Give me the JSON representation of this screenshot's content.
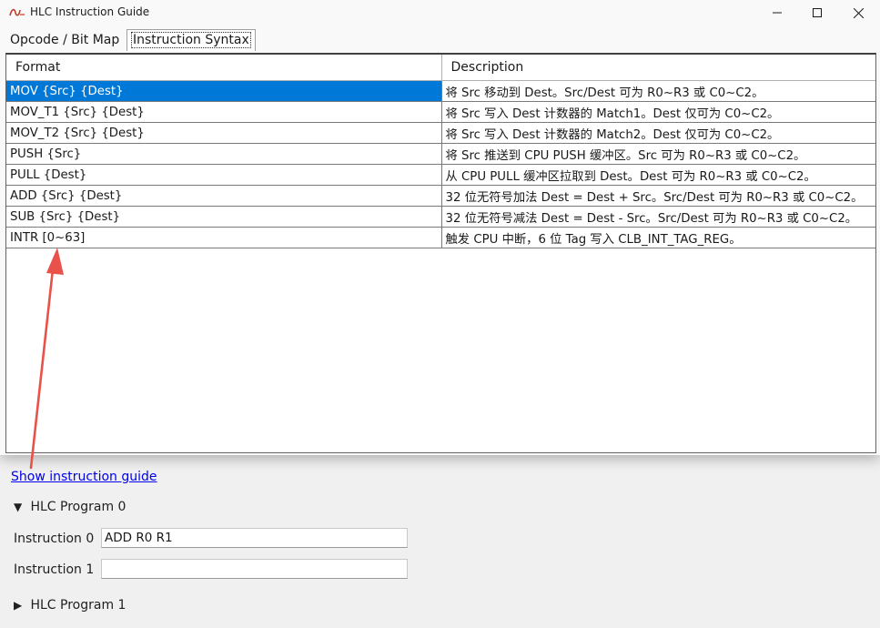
{
  "window": {
    "title": "HLC Instruction Guide",
    "icon": "hlc-app-icon",
    "controls": [
      "minimize-icon",
      "maximize-icon",
      "close-icon"
    ]
  },
  "tabs": [
    {
      "label": "Opcode / Bit Map",
      "active": false
    },
    {
      "label": "Instruction Syntax",
      "active": true
    }
  ],
  "table": {
    "headers": {
      "format": "Format",
      "description": "Description"
    },
    "rows": [
      {
        "format": "MOV {Src} {Dest}",
        "description": "将 Src 移动到 Dest。Src/Dest 可为 R0~R3 或 C0~C2。",
        "selected": true
      },
      {
        "format": "MOV_T1 {Src} {Dest}",
        "description": "将 Src 写入 Dest 计数器的 Match1。Dest 仅可为 C0~C2。"
      },
      {
        "format": "MOV_T2 {Src} {Dest}",
        "description": "将 Src 写入 Dest 计数器的 Match2。Dest 仅可为 C0~C2。"
      },
      {
        "format": "PUSH {Src}",
        "description": "将 Src 推送到 CPU PUSH 缓冲区。Src 可为 R0~R3 或 C0~C2。"
      },
      {
        "format": "PULL {Dest}",
        "description": "从 CPU PULL 缓冲区拉取到 Dest。Dest 可为 R0~R3 或 C0~C2。"
      },
      {
        "format": "ADD {Src} {Dest}",
        "description": "32 位无符号加法 Dest = Dest + Src。Src/Dest 可为 R0~R3 或 C0~C2。"
      },
      {
        "format": "SUB {Src} {Dest}",
        "description": "32 位无符号减法 Dest = Dest - Src。Src/Dest 可为 R0~R3 或 C0~C2。"
      },
      {
        "format": "INTR [0~63]",
        "description": "触发 CPU 中断，6 位 Tag 写入 CLB_INT_TAG_REG。"
      }
    ]
  },
  "host": {
    "guide_link": "Show instruction guide",
    "program0": {
      "title": "HLC Program 0",
      "expanded": true,
      "glyph": "▼"
    },
    "program1": {
      "title": "HLC Program 1",
      "expanded": false,
      "glyph": "▶"
    },
    "instructions": [
      {
        "label": "Instruction 0",
        "value": "ADD R0 R1"
      },
      {
        "label": "Instruction 1",
        "value": ""
      }
    ]
  },
  "colors": {
    "selection": "#0078d7",
    "link": "#0000ee",
    "annotation_arrow": "#e8524a"
  }
}
